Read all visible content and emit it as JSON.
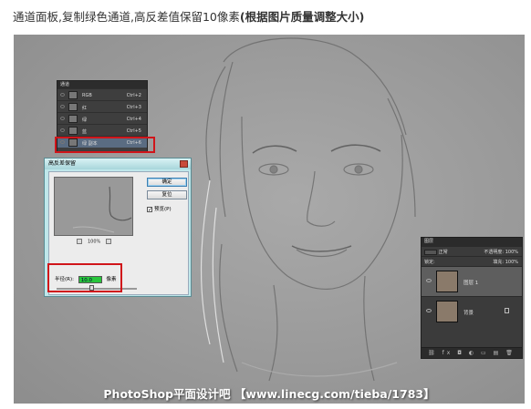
{
  "caption": {
    "text": "通道面板,复制绿色通道,高反差值保留10像素",
    "bold": "(根据图片质量调整大小)"
  },
  "watermark": "PhotoShop平面设计吧 【www.linecg.com/tieba/1783】",
  "channels_panel": {
    "title": "通道",
    "rows": [
      {
        "name": "RGB",
        "shortcut": "Ctrl+2",
        "selected": false
      },
      {
        "name": "红",
        "shortcut": "Ctrl+3",
        "selected": false
      },
      {
        "name": "绿",
        "shortcut": "Ctrl+4",
        "selected": false
      },
      {
        "name": "蓝",
        "shortcut": "Ctrl+5",
        "selected": false
      },
      {
        "name": "绿 副本",
        "shortcut": "Ctrl+6",
        "selected": true
      }
    ]
  },
  "high_pass_dialog": {
    "title": "高反差保留",
    "ok_label": "确定",
    "reset_label": "复位",
    "preview_label": "预览(P)",
    "preview_checked": true,
    "zoom": "100%",
    "radius_label": "半径(R):",
    "radius_value": "10.0",
    "radius_unit": "像素"
  },
  "layers_panel": {
    "title": "图层",
    "mode": "正常",
    "opacity_label": "不透明度:",
    "opacity_value": "100%",
    "lock_label": "锁定:",
    "fill_label": "填充:",
    "fill_value": "100%",
    "layers": [
      {
        "name": "图层 1",
        "selected": true
      },
      {
        "name": "背景",
        "selected": false
      }
    ],
    "footer_icons": "⛓ fx ◘ ◐ ▭ ▤ 🗑"
  },
  "colors": {
    "highlight_red": "#d0151a",
    "dialog_bg": "#bfe7ea",
    "radius_field": "#28c63c"
  }
}
